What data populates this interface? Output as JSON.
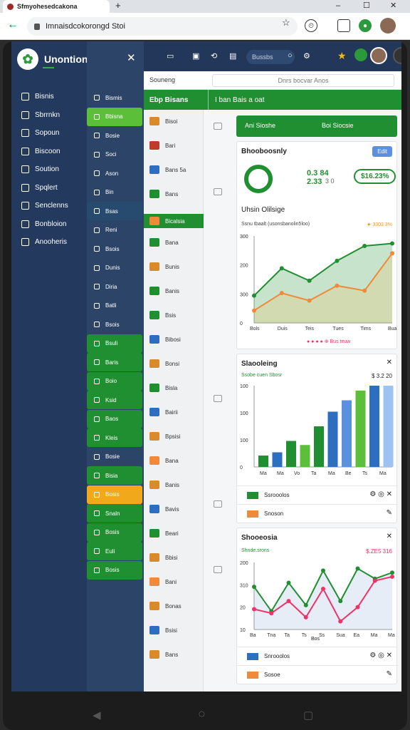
{
  "browser": {
    "tab_title": "Sfmyohesedcakona",
    "url": "Imnaisdcokorongd Stoi",
    "new_tab": "+",
    "minimize": "–",
    "maximize": "☐",
    "close": "✕"
  },
  "app": {
    "brand": "Unontional",
    "close": "✕"
  },
  "nav_primary": [
    {
      "label": "Bisnis"
    },
    {
      "label": "Sbrrnkn"
    },
    {
      "label": "Sopoun"
    },
    {
      "label": "Biscoon"
    },
    {
      "label": "Soution"
    },
    {
      "label": "Spqlert"
    },
    {
      "label": "Senclenns"
    },
    {
      "label": "Bonbloion"
    },
    {
      "label": "Anooheris"
    }
  ],
  "nav_secondary": [
    {
      "label": "Bismis"
    },
    {
      "label": "Bbisna"
    },
    {
      "label": "Bosie"
    },
    {
      "label": "Soci"
    },
    {
      "label": "Ason"
    },
    {
      "label": "Bin"
    },
    {
      "label": "Bsas"
    },
    {
      "label": "Reni"
    },
    {
      "label": "Bsois"
    },
    {
      "label": "Dunis"
    },
    {
      "label": "Diria"
    },
    {
      "label": "Batli"
    },
    {
      "label": "Bsois"
    },
    {
      "label": "Bsuli"
    },
    {
      "label": "Baris"
    },
    {
      "label": "Boio"
    },
    {
      "label": "Ksid"
    },
    {
      "label": "Baos"
    },
    {
      "label": "Kleis"
    },
    {
      "label": "Bosie"
    },
    {
      "label": "Bisia"
    },
    {
      "label": "Bosis"
    },
    {
      "label": "Snaln"
    },
    {
      "label": "Bosis"
    },
    {
      "label": "Euli"
    },
    {
      "label": "Bosis"
    }
  ],
  "topbar": {
    "search_placeholder": "Bussbs"
  },
  "subheader": {
    "left": "Souneng",
    "search_text": "Dnrs bocvar Anos"
  },
  "greenbar": {
    "left": "Ebp Bisans",
    "right": "I ban Bais a oat"
  },
  "list_items": [
    "Bisoi",
    "Bari",
    "Bans 5a",
    "Bans",
    "Bicalsia",
    "Bana",
    "Bunis",
    "Banis",
    "Bsis",
    "Bibosi",
    "Bonsi",
    "Bisla",
    "Bairii",
    "Bpsisi",
    "Bana",
    "Banis",
    "Bavis",
    "Beari",
    "Bbisi",
    "Bani",
    "Bonas",
    "Bsisi",
    "Bans"
  ],
  "kpi_tabs": {
    "a": "Ani  Sioshe",
    "b": "Boi  Siocsie",
    "edit": "Edit"
  },
  "card1": {
    "title": "Bhooboosnly",
    "kpi_big": "0.3 84\n2.33",
    "kpi_small": "3 0",
    "badge": "$16.23%",
    "subtitle": "Uhsin Olilsige",
    "chart_label": "Ssnu tbaalt (usonsbanolin5loo)",
    "chart_value": "★ 3303 3%",
    "yticks": [
      "300",
      "200",
      "300",
      "0"
    ],
    "xticks": [
      "Bols",
      "Duis",
      "Teis",
      "Tues",
      "Tims",
      "Bua"
    ],
    "legend": "● ● ● ●   ⊕ Bus teuw"
  },
  "card2": {
    "title": "Slaooleing",
    "label": "Ssobe cuen Sbosr",
    "value": "$ 3.2 20",
    "yticks": [
      "100",
      "100",
      "100",
      "0"
    ],
    "xticks": [
      "Ma",
      "Ma",
      "Vo",
      "Ta",
      "Ma",
      "Be",
      "Ts",
      "Ma"
    ],
    "row1": "Ssrooolos",
    "row2": "Snoson"
  },
  "card3": {
    "title": "Shooeosia",
    "label": "Shnde.srons",
    "value": "$.ZE5 316",
    "yticks": [
      "200",
      "310",
      "20",
      "10"
    ],
    "xticks": [
      "Ba",
      "Tna",
      "Ta",
      "Ts",
      "Ss",
      "Sua",
      "Ea",
      "Ma",
      "Ma"
    ],
    "xlabel": "Bos",
    "row1": "Snrooolos",
    "row2": "Sosoe"
  },
  "colors": {
    "green": "#1f8f31",
    "navy": "#23395d",
    "orange": "#f1a81b",
    "blue": "#2e6ec0"
  },
  "chart_data": [
    {
      "type": "line",
      "title": "Uhsin Olilsige",
      "categories": [
        "Bols",
        "Duis",
        "Teis",
        "Tues",
        "Tims",
        "Bua"
      ],
      "series": [
        {
          "values": [
            110,
            220,
            170,
            250,
            310,
            320
          ]
        },
        {
          "values": [
            50,
            120,
            90,
            150,
            130,
            280
          ]
        }
      ]
    },
    {
      "type": "bar",
      "title": "Slaooleing",
      "values": [
        14,
        18,
        32,
        27,
        50,
        68,
        82,
        94,
        100,
        100
      ]
    },
    {
      "type": "line",
      "title": "Shooeosia",
      "categories": [
        "Ba",
        "Tna",
        "Ta",
        "Ts",
        "Ss",
        "Sua",
        "Ea",
        "Ma",
        "Ma"
      ],
      "series": [
        {
          "values": [
            210,
            90,
            230,
            120,
            290,
            140,
            300,
            250,
            280
          ]
        },
        {
          "values": [
            100,
            80,
            140,
            60,
            200,
            40,
            110,
            240,
            260
          ]
        }
      ]
    }
  ]
}
